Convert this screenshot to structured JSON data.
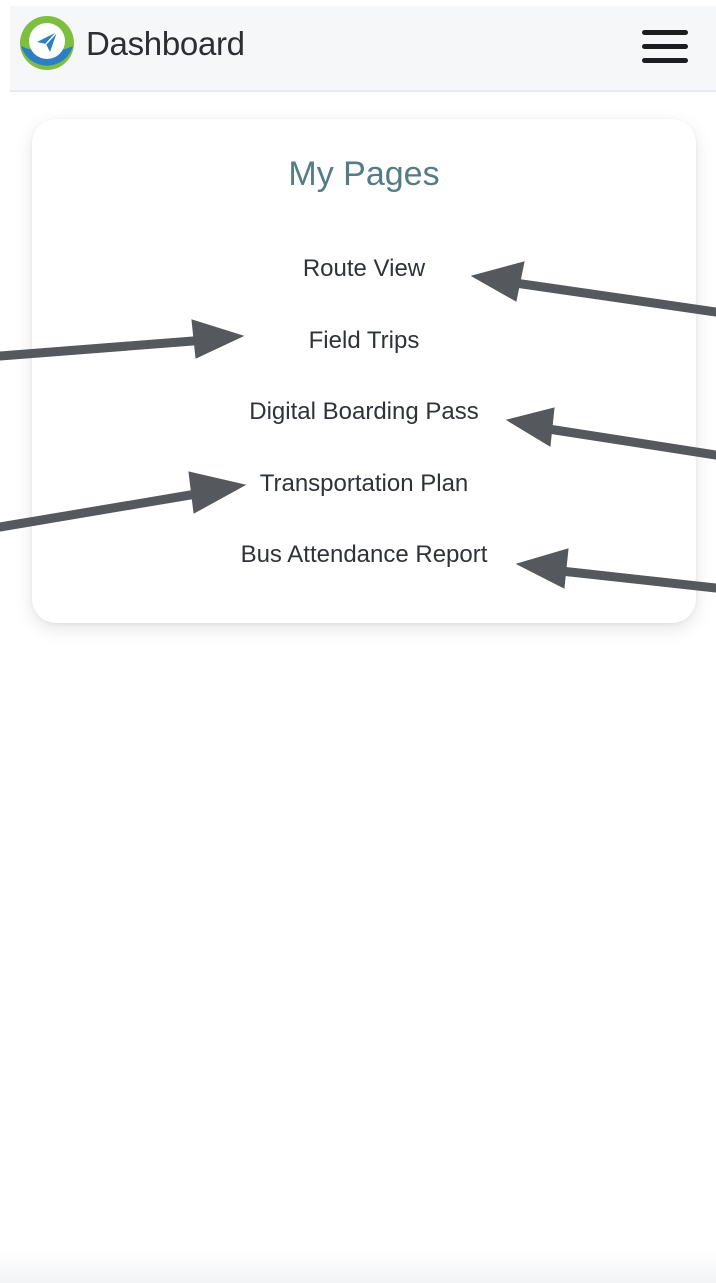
{
  "header": {
    "title": "Dashboard",
    "logo_icon": "app-logo-icon",
    "menu_icon": "hamburger-menu-icon"
  },
  "card": {
    "title": "My Pages",
    "links": [
      "Route View",
      "Field Trips",
      "Digital Boarding Pass",
      "Transportation Plan",
      "Bus Attendance Report"
    ]
  },
  "colors": {
    "header_bg": "#f6f7f8",
    "card_title": "#547c86",
    "link_text": "#2f3338",
    "arrow": "#55585c",
    "logo_green": "#7fbf3f",
    "logo_blue": "#2e7ec6"
  }
}
